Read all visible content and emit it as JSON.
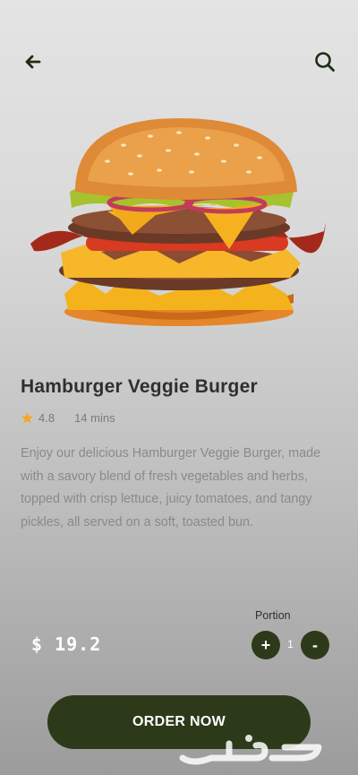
{
  "header": {
    "back_icon": "arrow-left-icon",
    "search_icon": "search-icon"
  },
  "product": {
    "name": "Hamburger Veggie Burger",
    "rating": "4.8",
    "time": "14 mins",
    "description": "Enjoy our delicious Hamburger Veggie Burger, made with a savory blend of fresh vegetables and herbs, topped with crisp lettuce, juicy tomatoes, and tangy pickles, all served on a soft, toasted bun."
  },
  "order": {
    "portion_label": "Portion",
    "price": "$ 19.2",
    "quantity": "1",
    "plus_label": "+",
    "minus_label": "-",
    "order_button_label": "ORDER NOW"
  },
  "colors": {
    "accent": "#2d3a19",
    "star": "#f5a623"
  },
  "watermark": {
    "text": "حراج"
  }
}
